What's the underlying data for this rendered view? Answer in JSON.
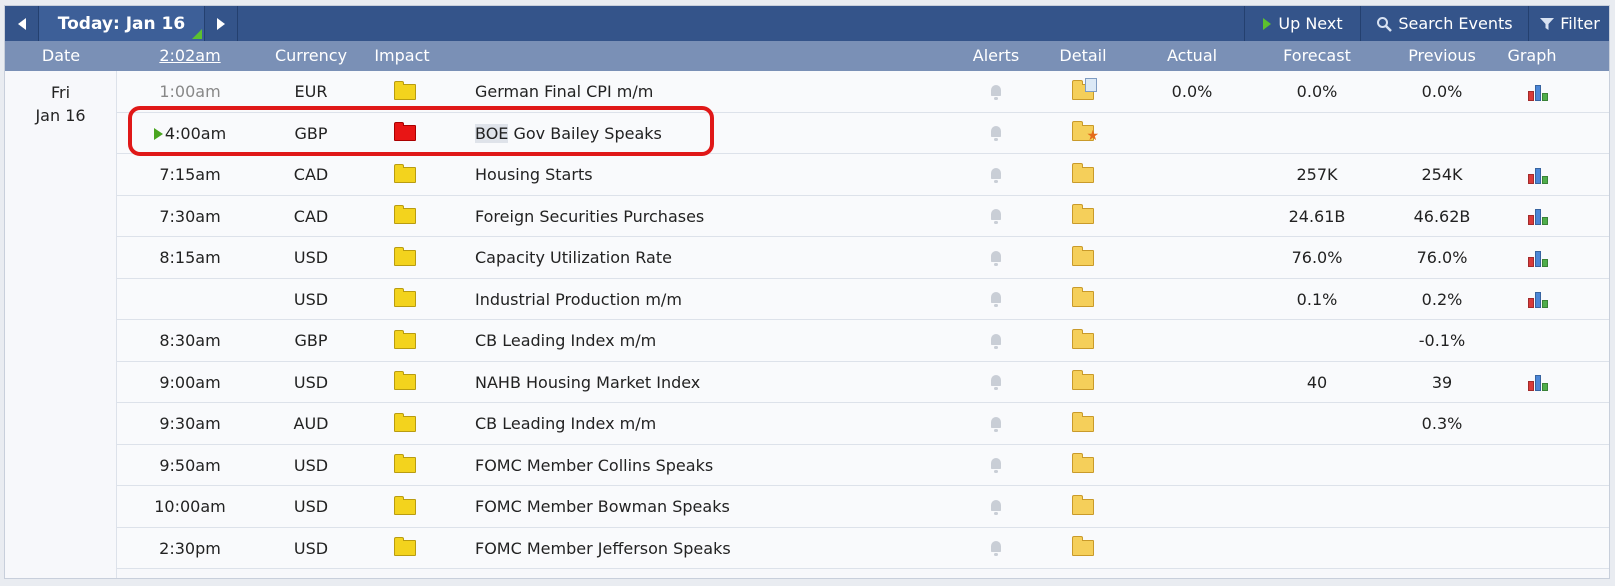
{
  "toolbar": {
    "prev_icon": "caret-left",
    "today_label": "Today: Jan 16",
    "next_icon": "caret-right",
    "up_next_label": "Up Next",
    "search_label": "Search Events",
    "filter_label": "Filter"
  },
  "columns": {
    "date": "Date",
    "time": "2:02am",
    "currency": "Currency",
    "impact": "Impact",
    "alerts": "Alerts",
    "detail": "Detail",
    "actual": "Actual",
    "forecast": "Forecast",
    "previous": "Previous",
    "graph": "Graph"
  },
  "date": {
    "day": "Fri",
    "date": "Jan 16"
  },
  "colors": {
    "low_impact": "#f3d31d",
    "high_impact": "#e81515",
    "toolbar": "#34548a",
    "header": "#7a90b6",
    "annotation": "#e01818"
  },
  "events": [
    {
      "time": "1:00am",
      "currency": "EUR",
      "impact": "low",
      "event": "German Final CPI m/m",
      "detail_icon": "folder-doc-icon",
      "actual": "0.0%",
      "forecast": "0.0%",
      "previous": "0.0%",
      "graph": true
    },
    {
      "time": "4:00am",
      "currency": "GBP",
      "impact": "high",
      "event_prefix": "BOE",
      "event": " Gov Bailey Speaks",
      "detail_icon": "folder-star-icon",
      "actual": "",
      "forecast": "",
      "previous": "",
      "graph": false
    },
    {
      "time": "7:15am",
      "currency": "CAD",
      "impact": "low",
      "event": "Housing Starts",
      "detail_icon": "folder-icon",
      "actual": "",
      "forecast": "257K",
      "previous": "254K",
      "graph": true
    },
    {
      "time": "7:30am",
      "currency": "CAD",
      "impact": "low",
      "event": "Foreign Securities Purchases",
      "detail_icon": "folder-icon",
      "actual": "",
      "forecast": "24.61B",
      "previous": "46.62B",
      "graph": true
    },
    {
      "time": "8:15am",
      "currency": "USD",
      "impact": "low",
      "event": "Capacity Utilization Rate",
      "detail_icon": "folder-icon",
      "actual": "",
      "forecast": "76.0%",
      "previous": "76.0%",
      "graph": true
    },
    {
      "time": "",
      "currency": "USD",
      "impact": "low",
      "event": "Industrial Production m/m",
      "detail_icon": "folder-icon",
      "actual": "",
      "forecast": "0.1%",
      "previous": "0.2%",
      "graph": true
    },
    {
      "time": "8:30am",
      "currency": "GBP",
      "impact": "low",
      "event": "CB Leading Index m/m",
      "detail_icon": "folder-icon",
      "actual": "",
      "forecast": "",
      "previous": "-0.1%",
      "graph": false
    },
    {
      "time": "9:00am",
      "currency": "USD",
      "impact": "low",
      "event": "NAHB Housing Market Index",
      "detail_icon": "folder-icon",
      "actual": "",
      "forecast": "40",
      "previous": "39",
      "graph": true
    },
    {
      "time": "9:30am",
      "currency": "AUD",
      "impact": "low",
      "event": "CB Leading Index m/m",
      "detail_icon": "folder-icon",
      "actual": "",
      "forecast": "",
      "previous": "0.3%",
      "graph": false
    },
    {
      "time": "9:50am",
      "currency": "USD",
      "impact": "low",
      "event": "FOMC Member Collins Speaks",
      "detail_icon": "folder-icon",
      "actual": "",
      "forecast": "",
      "previous": "",
      "graph": false
    },
    {
      "time": "10:00am",
      "currency": "USD",
      "impact": "low",
      "event": "FOMC Member Bowman Speaks",
      "detail_icon": "folder-icon",
      "actual": "",
      "forecast": "",
      "previous": "",
      "graph": false
    },
    {
      "time": "2:30pm",
      "currency": "USD",
      "impact": "low",
      "event": "FOMC Member Jefferson Speaks",
      "detail_icon": "folder-icon",
      "actual": "",
      "forecast": "",
      "previous": "",
      "graph": false
    }
  ]
}
